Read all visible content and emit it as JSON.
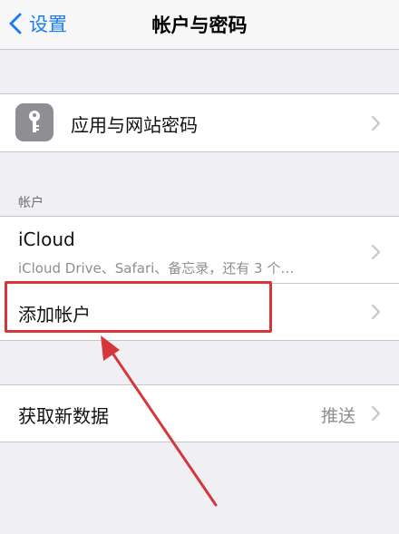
{
  "navbar": {
    "back_label": "设置",
    "title": "帐户与密码"
  },
  "app_passwords": {
    "label": "应用与网站密码"
  },
  "accounts_section": {
    "header": "帐户",
    "icloud": {
      "label": "iCloud",
      "subtitle": "iCloud Drive、Safari、备忘录，还有 3 个…"
    },
    "add_account": {
      "label": "添加帐户"
    }
  },
  "fetch": {
    "label": "获取新数据",
    "value": "推送"
  },
  "colors": {
    "accent": "#1a7cf5",
    "highlight": "#d6363a",
    "background": "#efeff4"
  }
}
